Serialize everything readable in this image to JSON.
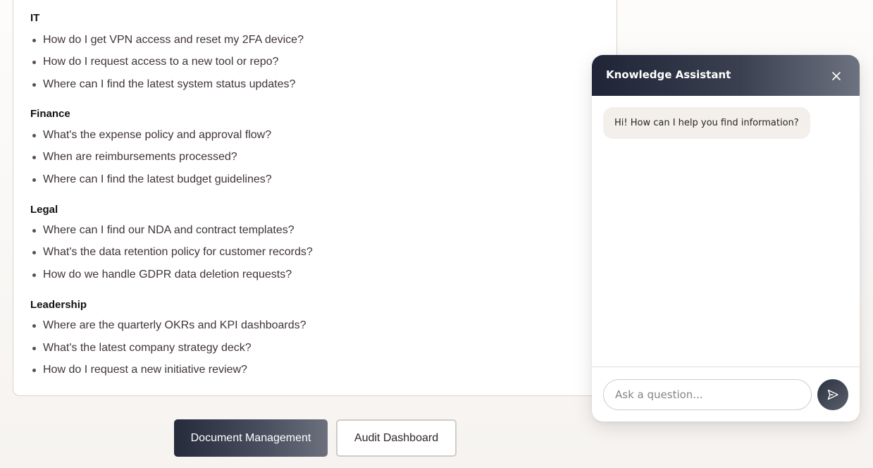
{
  "faq": {
    "sections": [
      {
        "title": "IT",
        "items": [
          "How do I get VPN access and reset my 2FA device?",
          "How do I request access to a new tool or repo?",
          "Where can I find the latest system status updates?"
        ]
      },
      {
        "title": "Finance",
        "items": [
          "What's the expense policy and approval flow?",
          "When are reimbursements processed?",
          "Where can I find the latest budget guidelines?"
        ]
      },
      {
        "title": "Legal",
        "items": [
          "Where can I find our NDA and contract templates?",
          "What's the data retention policy for customer records?",
          "How do we handle GDPR data deletion requests?"
        ]
      },
      {
        "title": "Leadership",
        "items": [
          "Where are the quarterly OKRs and KPI dashboards?",
          "What's the latest company strategy deck?",
          "How do I request a new initiative review?"
        ]
      }
    ]
  },
  "nav": {
    "document_management": "Document Management",
    "audit_dashboard": "Audit Dashboard"
  },
  "chat": {
    "title": "Knowledge Assistant",
    "close_icon": "close-icon",
    "messages": [
      {
        "sender": "assistant",
        "text": "Hi! How can I help you find information?"
      }
    ],
    "input_placeholder": "Ask a question...",
    "input_value": "",
    "send_icon": "send-icon"
  },
  "colors": {
    "accent_dark": "#252b3b",
    "accent_light": "#6b707c",
    "bubble_bg": "#f3efeb"
  }
}
